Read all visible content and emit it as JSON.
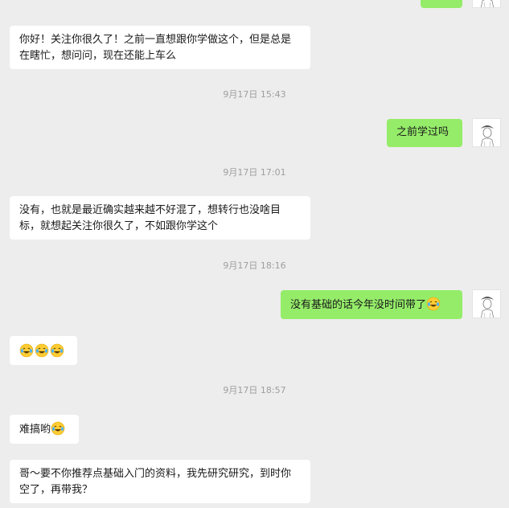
{
  "conversation": {
    "timestamps": [
      "9月17日 15:43",
      "9月17日 17:01",
      "9月17日 18:16",
      "9月17日 18:57"
    ],
    "messages": [
      {
        "side": "left",
        "text": "你好！关注你很久了！之前一直想跟你学做这个，但是总是在瞎忙，想问问，现在还能上车么"
      },
      {
        "side": "right",
        "text": "之前学过吗"
      },
      {
        "side": "left",
        "text": "没有，也就是最近确实越来越不好混了，想转行也没啥目标，就想起关注你很久了，不如跟你学这个"
      },
      {
        "side": "right",
        "text": "没有基础的话今年没时间带了",
        "emoji": "laughing-crying-emoji"
      },
      {
        "side": "left",
        "text": "",
        "emoji": "laughing-crying-emoji x3"
      },
      {
        "side": "left",
        "text": "难搞哟",
        "emoji": "laughing-crying-emoji"
      },
      {
        "side": "left",
        "text": "哥～要不你推荐点基础入门的资料，我先研究研究，到时你空了，再带我？"
      }
    ]
  },
  "colors": {
    "background": "#ededed",
    "left_bubble": "#ffffff",
    "right_bubble": "#95ec69",
    "timestamp_text": "#9e9e9e"
  },
  "icons": {
    "avatar": "sketch-portrait-avatar",
    "emoji": "rolling-on-floor-laughing-emoji"
  }
}
